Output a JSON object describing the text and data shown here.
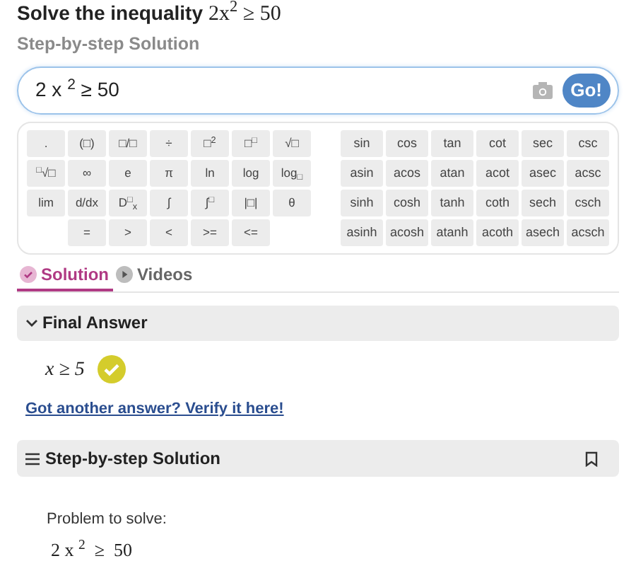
{
  "title": {
    "text": "Solve the inequality",
    "math": "2x$^{2}$ ≥ 50"
  },
  "subtitle": "Step-by-step Solution",
  "input": {
    "value": "2 x $^{2}$ ≥ 50",
    "go": "Go!"
  },
  "keypad_left": [
    [
      {
        "kind": "key",
        "label": "."
      },
      {
        "kind": "key",
        "label": "(□)"
      },
      {
        "kind": "key",
        "label": "□/□"
      },
      {
        "kind": "key",
        "label": "÷"
      },
      {
        "kind": "key",
        "label": "□$^{2}$"
      },
      {
        "kind": "key",
        "label": "□$^{□}$"
      },
      {
        "kind": "key",
        "label": "√□"
      }
    ],
    [
      {
        "kind": "key",
        "label": "$^{□}$√□"
      },
      {
        "kind": "key",
        "label": "∞"
      },
      {
        "kind": "key",
        "label": "e"
      },
      {
        "kind": "key",
        "label": "π"
      },
      {
        "kind": "key",
        "label": "ln"
      },
      {
        "kind": "key",
        "label": "log"
      },
      {
        "kind": "key",
        "label": "log$_{□}$"
      }
    ],
    [
      {
        "kind": "key",
        "label": "lim"
      },
      {
        "kind": "key",
        "label": "d/dx"
      },
      {
        "kind": "key",
        "label": "D$^{□}$$_{x}$"
      },
      {
        "kind": "key",
        "label": "∫"
      },
      {
        "kind": "key",
        "label": "∫$^{□}$"
      },
      {
        "kind": "key",
        "label": "|□|"
      },
      {
        "kind": "key",
        "label": "θ"
      }
    ],
    [
      {
        "kind": "blank"
      },
      {
        "kind": "key",
        "label": "="
      },
      {
        "kind": "key",
        "label": ">"
      },
      {
        "kind": "key",
        "label": "<"
      },
      {
        "kind": "key",
        "label": ">="
      },
      {
        "kind": "key",
        "label": "<="
      },
      {
        "kind": "blank"
      }
    ]
  ],
  "keypad_right": [
    [
      "sin",
      "cos",
      "tan",
      "cot",
      "sec",
      "csc"
    ],
    [
      "asin",
      "acos",
      "atan",
      "acot",
      "asec",
      "acsc"
    ],
    [
      "sinh",
      "cosh",
      "tanh",
      "coth",
      "sech",
      "csch"
    ],
    [
      "asinh",
      "acosh",
      "atanh",
      "acoth",
      "asech",
      "acsch"
    ]
  ],
  "tabs": [
    {
      "label": "Solution",
      "selected": true
    },
    {
      "label": "Videos",
      "selected": false
    }
  ],
  "final_answer": {
    "heading": "Final Answer",
    "answer": "x ≥ 5",
    "verify_link": "Got another answer? Verify it here!"
  },
  "steps": {
    "heading": "Step-by-step Solution",
    "problem_label": "Problem to solve:",
    "problem": "2 x $^{2}$  ≥  50"
  }
}
